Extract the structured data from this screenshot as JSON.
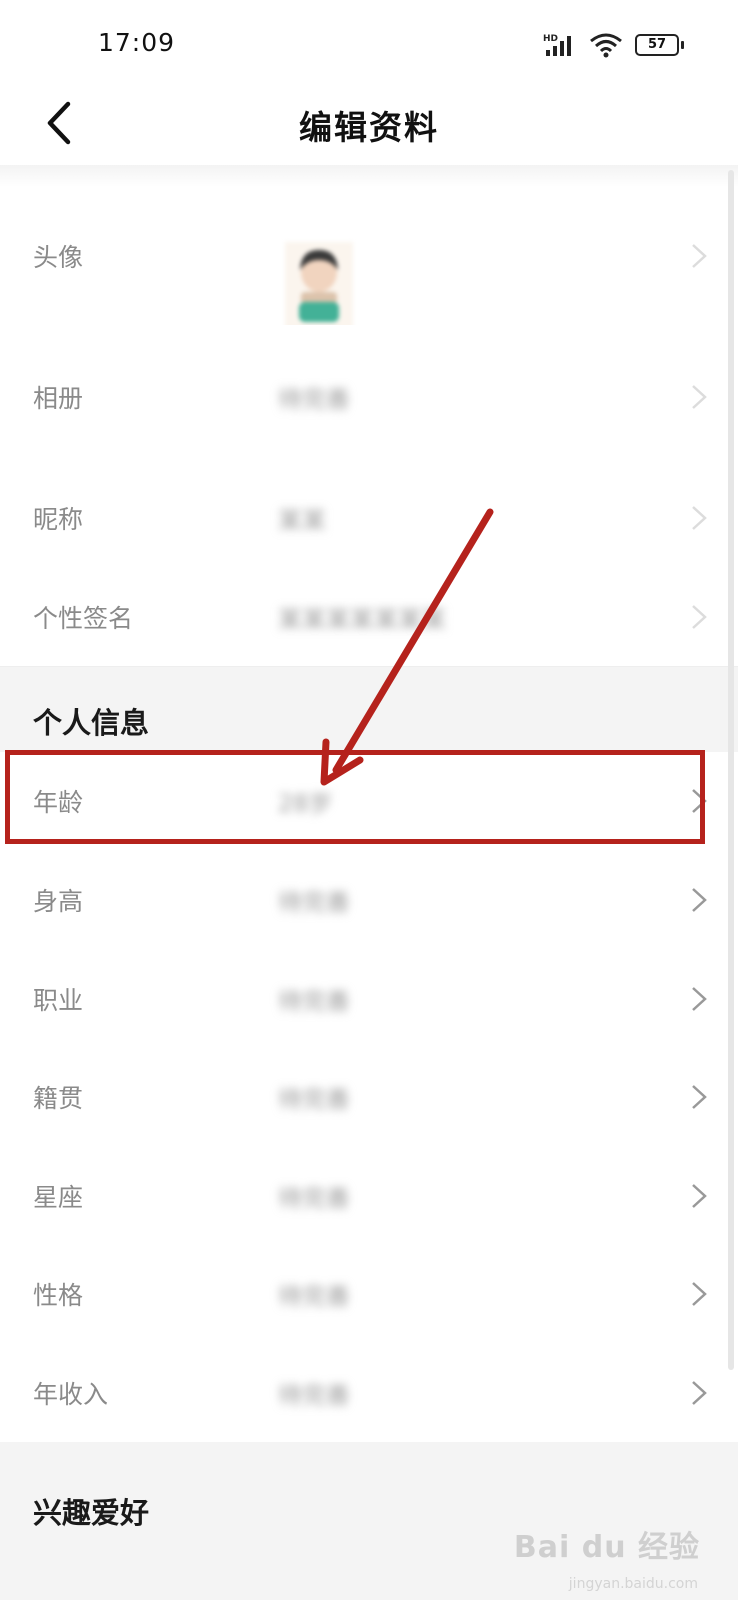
{
  "status_bar": {
    "time": "17:09",
    "network_label": "HD",
    "battery": "57"
  },
  "header": {
    "title": "编辑资料"
  },
  "basic_rows": [
    {
      "label": "头像"
    },
    {
      "label": "相册",
      "value": "待完善"
    },
    {
      "label": "昵称",
      "value": "某某"
    },
    {
      "label": "个性签名",
      "value": "某某某某某某某"
    }
  ],
  "sections": {
    "personal_info": "个人信息",
    "interests": "兴趣爱好"
  },
  "personal_rows": [
    {
      "label": "年龄",
      "value": "28岁"
    },
    {
      "label": "身高",
      "value": "待完善"
    },
    {
      "label": "职业",
      "value": "待完善"
    },
    {
      "label": "籍贯",
      "value": "待完善"
    },
    {
      "label": "星座",
      "value": "待完善"
    },
    {
      "label": "性格",
      "value": "待完善"
    },
    {
      "label": "年收入",
      "value": "待完善"
    }
  ],
  "watermark": {
    "brand": "Bai du 经验",
    "url": "jingyan.baidu.com"
  },
  "colors": {
    "annotation_red": "#b5221c",
    "background": "#f4f4f4"
  }
}
